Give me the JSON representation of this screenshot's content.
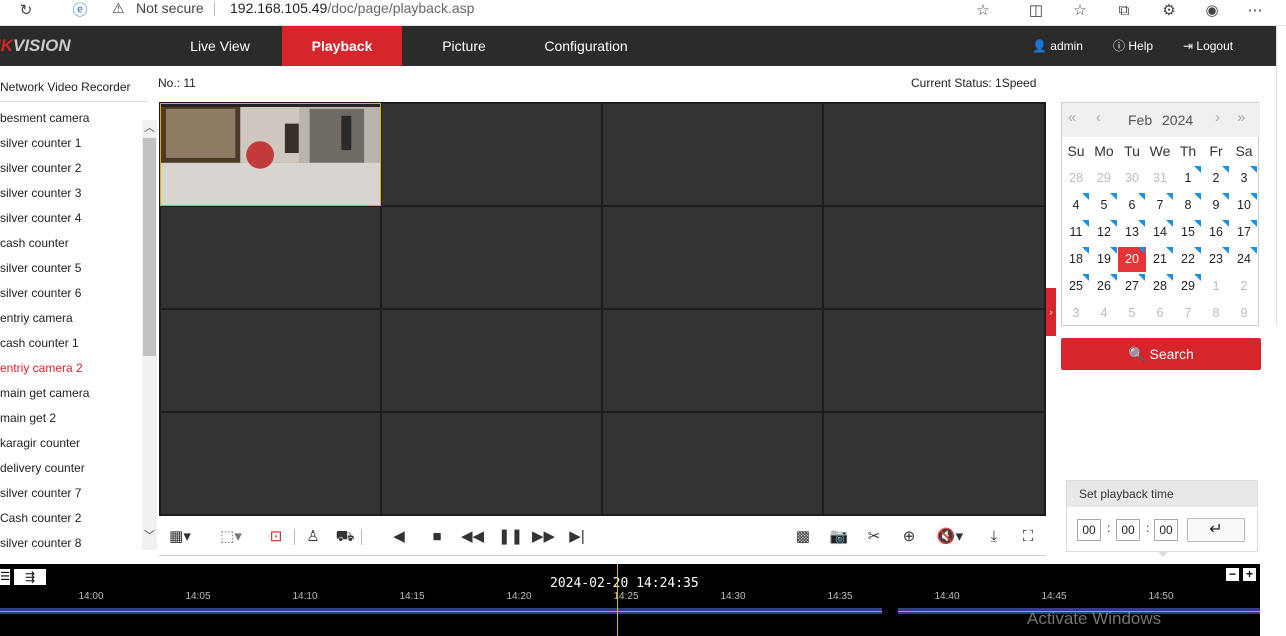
{
  "browser": {
    "security_label": "Not secure",
    "url_host": "192.168.105.49",
    "url_path": "/doc/page/playback.asp"
  },
  "nav": {
    "logo_left": "IK",
    "logo_right": "VISION",
    "tabs": [
      {
        "label": "Live View"
      },
      {
        "label": "Playback",
        "active": true
      },
      {
        "label": "Picture"
      },
      {
        "label": "Configuration"
      }
    ],
    "user": "admin",
    "help": "Help",
    "logout": "Logout"
  },
  "sidebar": {
    "title": "Network Video Recorder",
    "cameras": [
      "besment camera",
      "silver counter 1",
      "silver counter 2",
      "silver counter 3",
      "silver counter 4",
      "cash counter",
      "silver counter 5",
      "silver counter 6",
      "entriy camera",
      "cash counter 1",
      "entriy camera 2",
      "main get camera",
      "main get 2",
      "karagir counter",
      "delivery counter",
      "silver counter 7",
      "Cash counter 2",
      "silver counter 8"
    ],
    "active_index": 10
  },
  "main": {
    "no_label": "No.: 11",
    "status_label": "Current Status: 1Speed"
  },
  "calendar": {
    "month": "Feb",
    "year": "2024",
    "weekdays": [
      "Su",
      "Mo",
      "Tu",
      "We",
      "Th",
      "Fr",
      "Sa"
    ],
    "days": [
      "28",
      "29",
      "30",
      "31",
      "1",
      "2",
      "3",
      "4",
      "5",
      "6",
      "7",
      "8",
      "9",
      "10",
      "11",
      "12",
      "13",
      "14",
      "15",
      "16",
      "17",
      "18",
      "19",
      "20",
      "21",
      "22",
      "23",
      "24",
      "25",
      "26",
      "27",
      "28",
      "29",
      "1",
      "2",
      "3",
      "4",
      "5",
      "6",
      "7",
      "8",
      "9"
    ],
    "selected_day": "20",
    "search_label": "Search"
  },
  "playback_time": {
    "title": "Set playback time",
    "hh": "00",
    "mm": "00",
    "ss": "00",
    "sep": ":"
  },
  "timeline": {
    "current": "2024-02-20 14:24:35",
    "ticks": [
      "14:00",
      "14:05",
      "14:10",
      "14:15",
      "14:20",
      "14:25",
      "14:30",
      "14:35",
      "14:40",
      "14:45",
      "14:50"
    ]
  },
  "watermark": "Activate Windows",
  "colors": {
    "accent": "#d6252b",
    "nav_bg": "#2b2b2b",
    "record_marker": "#1e90e0",
    "selection": "#e0b000"
  }
}
